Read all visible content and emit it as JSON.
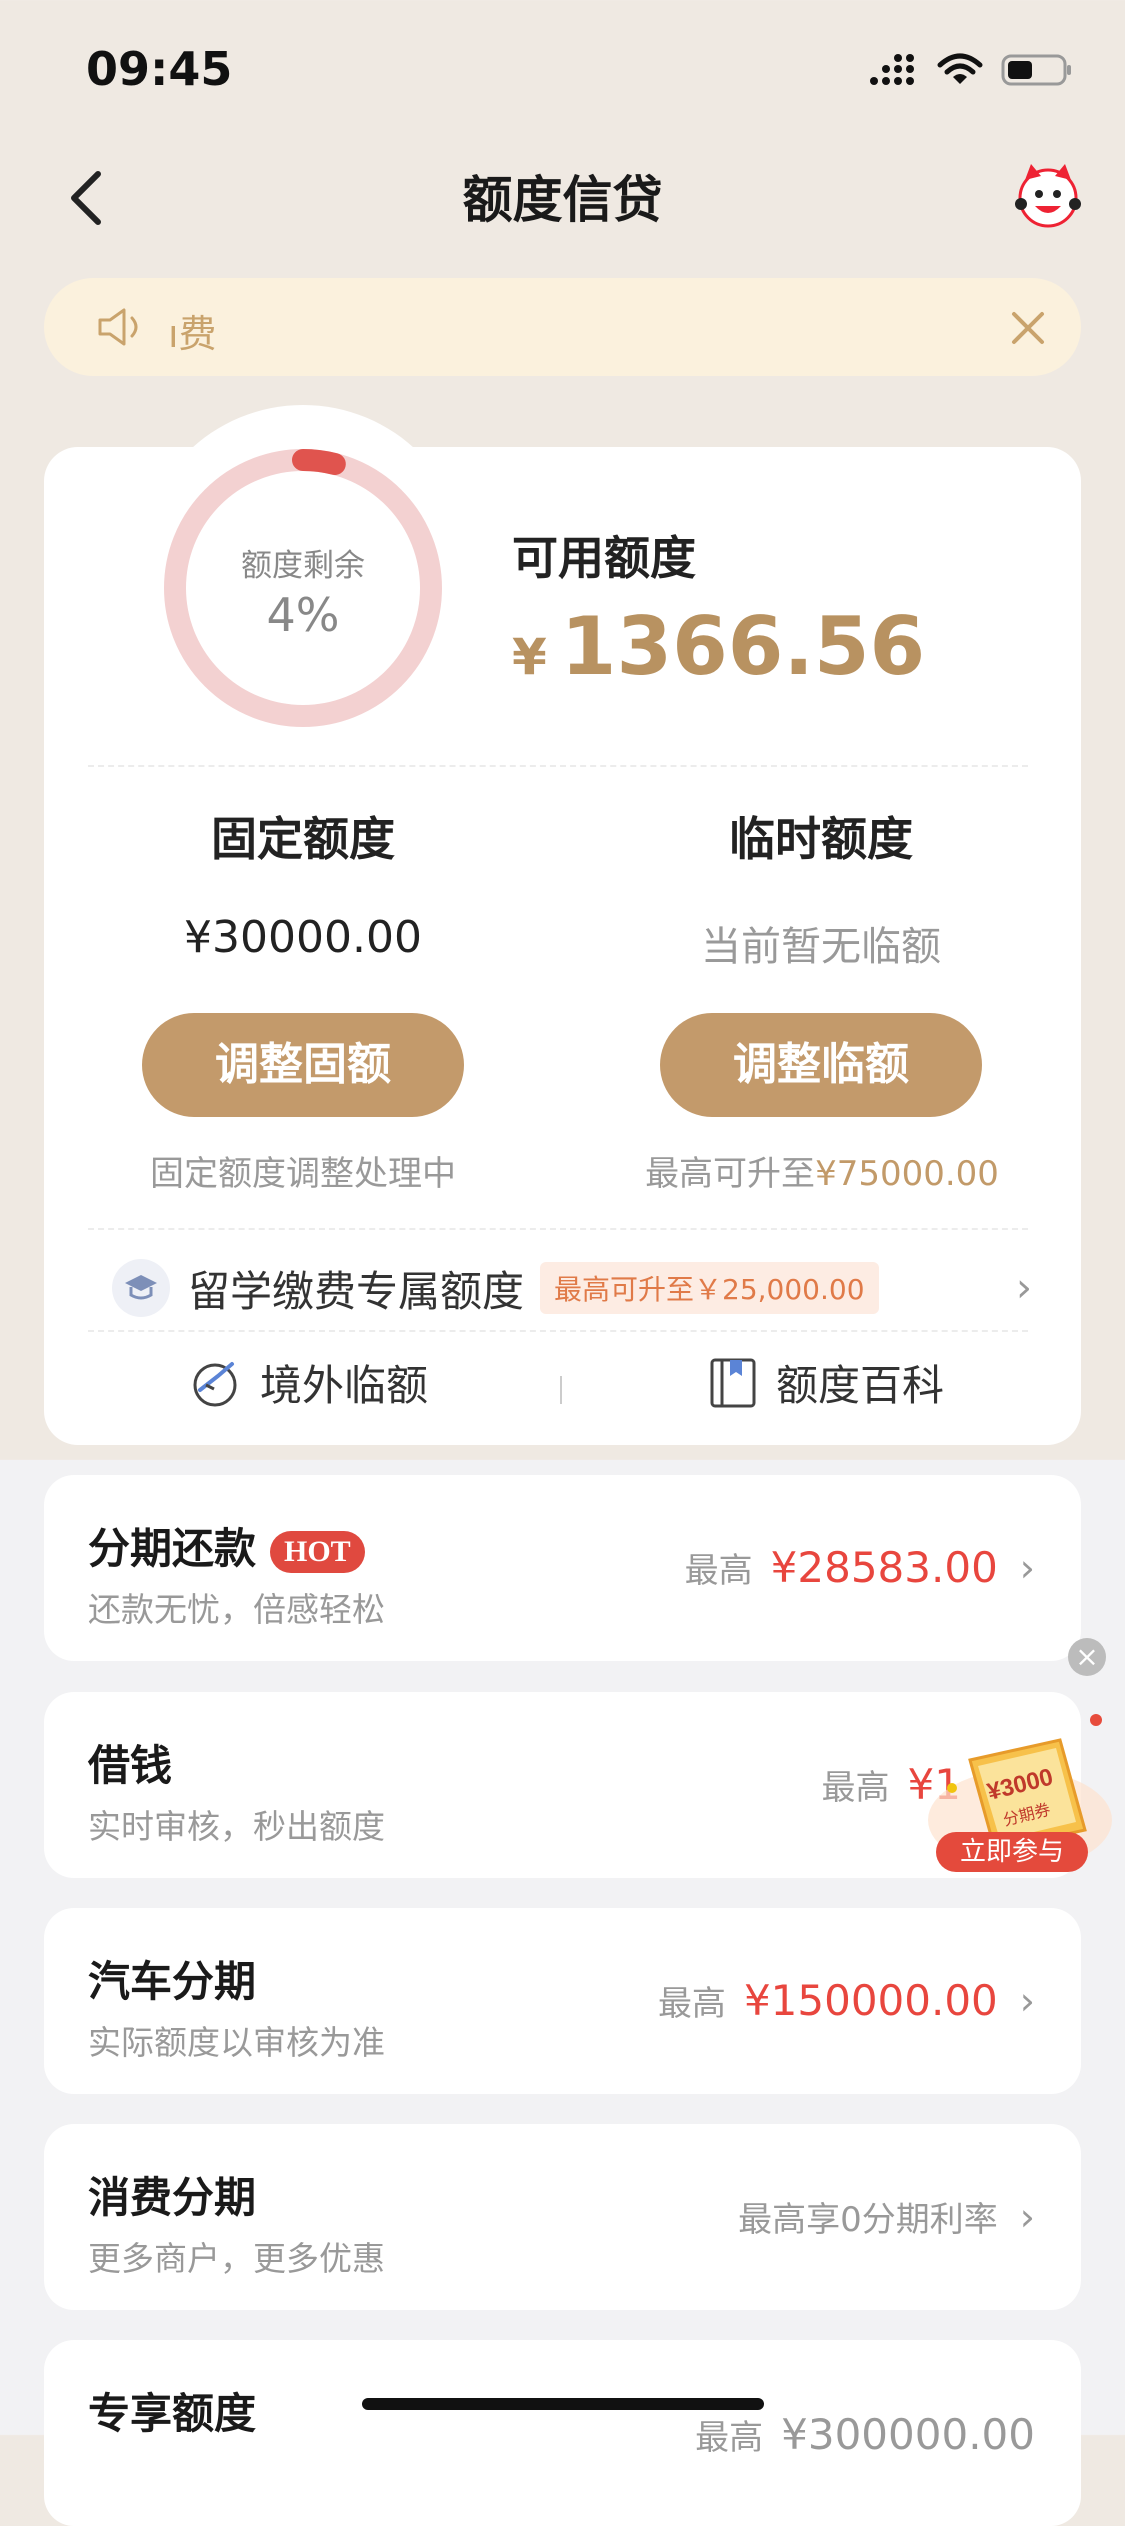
{
  "status_bar": {
    "time": "09:45"
  },
  "nav": {
    "title": "额度信贷"
  },
  "notice": {
    "text": "ı费"
  },
  "summary": {
    "ring_label": "额度剩余",
    "ring_percent": "4%",
    "ring_fraction": 0.04,
    "available_label": "可用额度",
    "available_currency": "¥",
    "available_amount": "1366.56"
  },
  "fixed": {
    "title": "固定额度",
    "value": "¥30000.00",
    "button": "调整固额",
    "note": "固定额度调整处理中"
  },
  "temp": {
    "title": "临时额度",
    "value": "当前暂无临额",
    "button": "调整临额",
    "note_prefix": "最高可升至",
    "note_amount": "¥75000.00"
  },
  "study": {
    "label": "留学缴费专属额度",
    "badge": "最高可升至￥25,000.00"
  },
  "links": {
    "overseas": "境外临额",
    "wiki": "额度百科"
  },
  "list": [
    {
      "title": "分期还款",
      "badge": "HOT",
      "subtitle": "还款无忧，倍感轻松",
      "prefix": "最高",
      "amount": "¥28583.00"
    },
    {
      "title": "借钱",
      "subtitle": "实时审核，秒出额度",
      "prefix": "最高",
      "amount": "¥1"
    },
    {
      "title": "汽车分期",
      "subtitle": "实际额度以审核为准",
      "prefix": "最高",
      "amount": "¥150000.00"
    },
    {
      "title": "消费分期",
      "subtitle": "更多商户，更多优惠",
      "prefix": "最高享0分期利率",
      "amount": ""
    },
    {
      "title": "专享额度",
      "subtitle": "",
      "prefix": "最高",
      "amount": "¥300000.00"
    }
  ],
  "float_ad": {
    "amount": "¥3000",
    "label": "分期券",
    "button": "立即参与"
  },
  "colors": {
    "gold": "#c39a6b",
    "red": "#e8463e",
    "ring": "#f2cfcf",
    "ring_progress": "#e0544e"
  }
}
